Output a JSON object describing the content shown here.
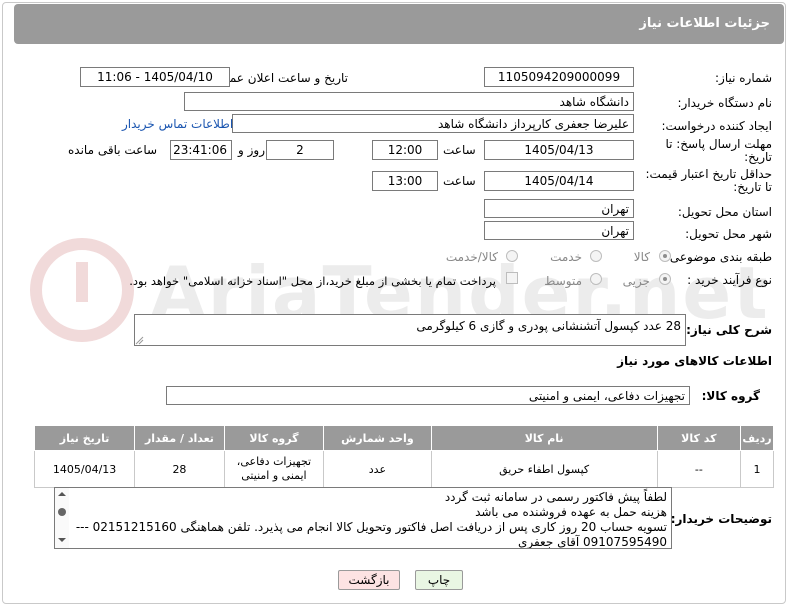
{
  "header": {
    "title": "جزئیات اطلاعات نیاز"
  },
  "fields": {
    "need_number_label": "شماره نیاز:",
    "need_number": "1105094209000099",
    "announce_label": "تاریخ و ساعت اعلان عمومی:",
    "announce_value": "1405/04/10 - 11:06",
    "buyer_org_label": "نام دستگاه خریدار:",
    "buyer_org": "دانشگاه شاهد",
    "creator_label": "ایجاد کننده درخواست:",
    "creator": "علیرضا جعفری کارپرداز دانشگاه شاهد",
    "contact_link": "اطلاعات تماس خریدار",
    "deadline_label_1": "مهلت ارسال پاسخ: تا",
    "deadline_label_2": "تاریخ:",
    "deadline_date": "1405/04/13",
    "time_label": "ساعت",
    "deadline_time": "12:00",
    "days": "2",
    "days_label": "روز و",
    "remaining": "23:41:06",
    "remaining_label": "ساعت باقی مانده",
    "price_label_1": "حداقل تاریخ اعتبار قیمت:",
    "price_label_2": "تا تاریخ:",
    "price_date": "1405/04/14",
    "price_time": "13:00",
    "province_label": "استان محل تحویل:",
    "province": "تهران",
    "city_label": "شهر محل تحویل:",
    "city": "تهران",
    "category_label": "طبقه بندی موضوعی:",
    "cat_goods": "کالا",
    "cat_service": "خدمت",
    "cat_goods_service": "کالا/خدمت",
    "process_label": "نوع فرآیند خرید :",
    "proc_partial": "جزیی",
    "proc_medium": "متوسط",
    "payment_note": "پرداخت تمام یا بخشی از مبلغ خرید،از محل \"اسناد خزانه اسلامی\" خواهد بود."
  },
  "description": {
    "label": "شرح کلی نیاز:",
    "text": "28 عدد کپسول آتشنشانی پودری و گازی  6 کیلوگرمی"
  },
  "goods_info": {
    "title": "اطلاعات کالاهای مورد نیاز",
    "group_label": "گروه کالا:",
    "group_value": "تجهیزات دفاعی، ایمنی و امنیتی"
  },
  "table": {
    "headers": [
      "ردیف",
      "کد کالا",
      "نام کالا",
      "واحد شمارش",
      "گروه کالا",
      "تعداد / مقدار",
      "تاریخ نیاز"
    ],
    "rows": [
      {
        "row": "1",
        "code": "--",
        "name": "کپسول اطفاء حریق",
        "unit": "عدد",
        "group_1": "تجهیزات دفاعی،",
        "group_2": "ایمنی و امنیتی",
        "qty": "28",
        "date": "1405/04/13"
      }
    ]
  },
  "buyer_notes": {
    "label": "توضیحات خریدار:",
    "lines": [
      "لطفاً پیش فاکتور رسمی در سامانه ثبت گردد",
      "هزینه حمل به عهده فروشنده می باشد",
      "تسویه حساب 20 روز کاری پس از دریافت اصل فاکتور وتحویل کالا انجام می پذیرد. تلفن هماهنگی   02151215160  ---",
      "09107595490 آقای جعفری"
    ]
  },
  "buttons": {
    "print": "چاپ",
    "back": "بازگشت"
  },
  "watermark": "AriaTender.net",
  "colors": {
    "header_bg": "#9a9a9a",
    "back_button_bg": "#fde3e3",
    "print_button_bg": "#e9f6e3",
    "link": "#1a55b0"
  }
}
